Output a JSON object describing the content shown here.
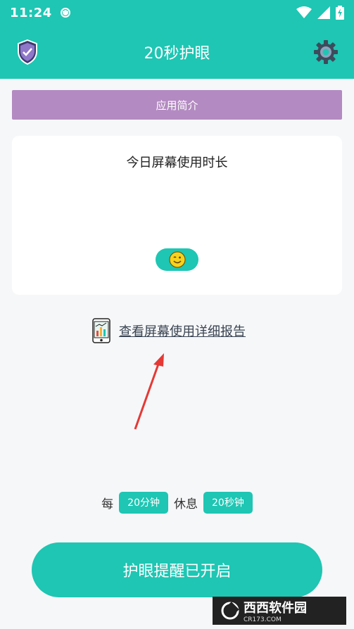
{
  "status_bar": {
    "time": "11:24",
    "icons": [
      "vpn-shield-icon",
      "wifi-icon",
      "signal-icon",
      "battery-charging-icon"
    ]
  },
  "app_bar": {
    "title": "20秒护眼",
    "left_icon": "shield-check-icon",
    "right_icon": "gear-icon"
  },
  "intro_button": {
    "label": "应用简介"
  },
  "screen_time_card": {
    "title": "今日屏幕使用时长",
    "emoji_icon": "wink-smiley-icon"
  },
  "report_link": {
    "icon": "phone-report-icon",
    "label": "查看屏幕使用详细报告"
  },
  "interval": {
    "prefix": "每",
    "every_value": "20分钟",
    "rest_label": "休息",
    "rest_value": "20秒钟"
  },
  "main_button": {
    "label": "护眼提醒已开启"
  },
  "watermark": {
    "text_cn": "西西软件园",
    "text_en": "CR173.COM"
  },
  "colors": {
    "primary": "#1ec6b3",
    "intro_purple": "#b38ac1",
    "background": "#f6f7f9",
    "annotation_arrow": "#e53935"
  }
}
